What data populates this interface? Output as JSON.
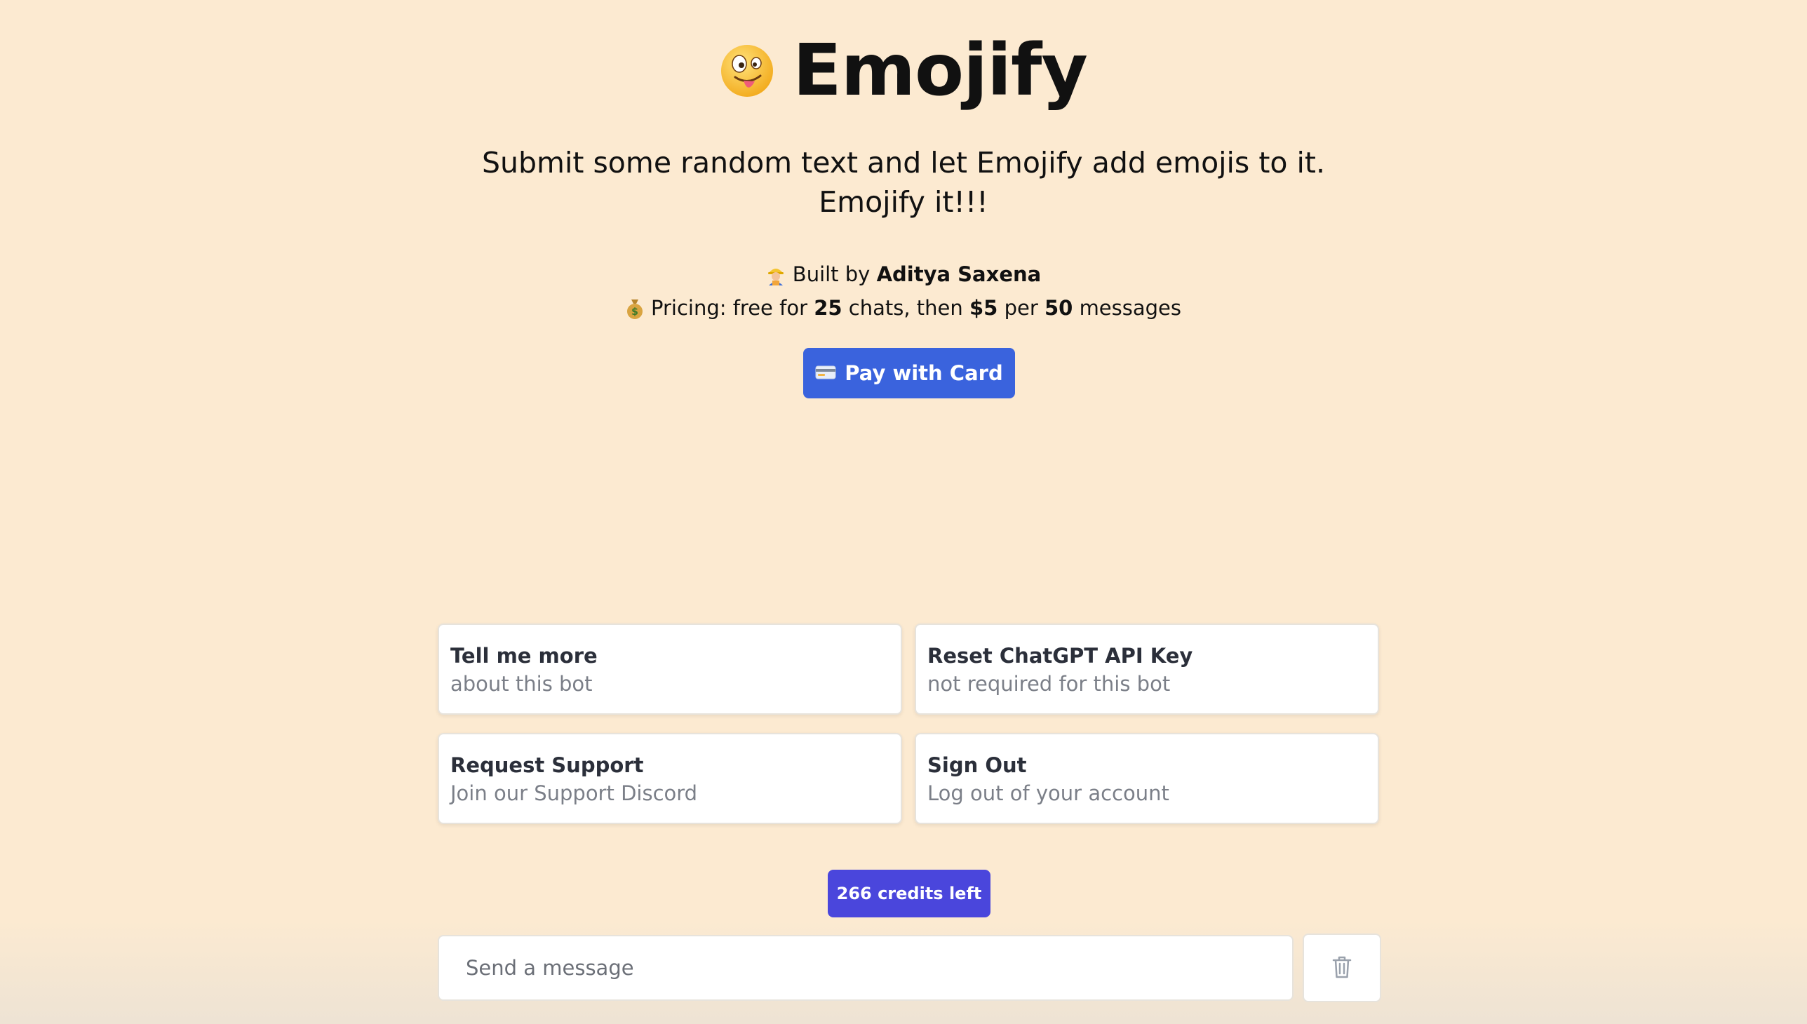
{
  "header": {
    "title_icon": "zany-face-emoji",
    "title": "Emojify",
    "subtitle": "Submit some random text and let Emojify add emojis to it. Emojify it!!!",
    "built_by": {
      "icon": "construction-worker-emoji",
      "prefix": "Built by",
      "name": "Aditya Saxena"
    },
    "pricing": {
      "icon": "money-bag-emoji",
      "prefix": "Pricing: free for",
      "free_count": "25",
      "middle": "chats, then",
      "price": "$5",
      "per": "per",
      "message_count": "50",
      "suffix": "messages"
    },
    "pay_button": {
      "icon": "credit-card-emoji",
      "label": "Pay with Card"
    }
  },
  "suggestions": [
    {
      "title": "Tell me more",
      "subtitle": "about this bot"
    },
    {
      "title": "Reset ChatGPT API Key",
      "subtitle": "not required for this bot"
    },
    {
      "title": "Request Support",
      "subtitle": "Join our Support Discord"
    },
    {
      "title": "Sign Out",
      "subtitle": "Log out of your account"
    }
  ],
  "credits": {
    "label": "266 credits left"
  },
  "composer": {
    "placeholder": "Send a message",
    "value": "",
    "clear_icon": "trash-icon"
  },
  "colors": {
    "background": "#fcead1",
    "primary_button": "#3a63dd",
    "credits_badge": "#4a46dc",
    "card_border": "#e7e3dc",
    "muted_text": "#7b7f88"
  }
}
